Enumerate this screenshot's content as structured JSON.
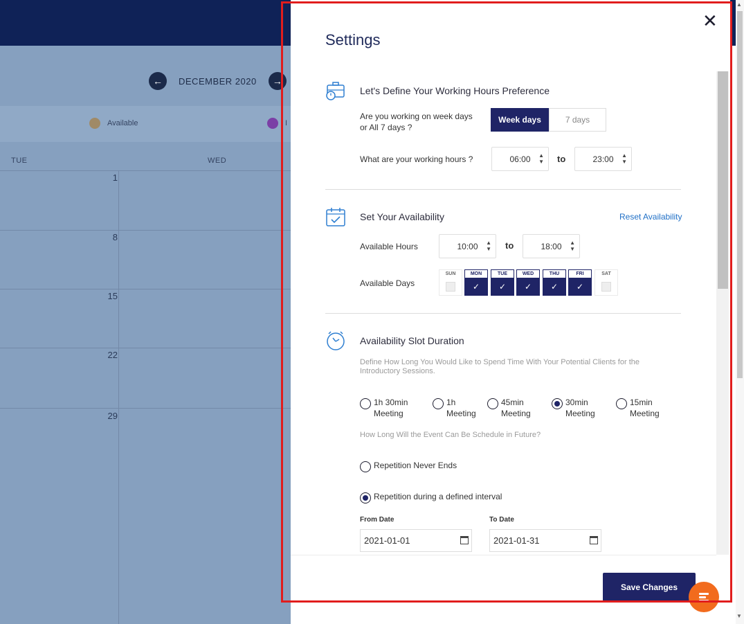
{
  "calendar": {
    "month": "DECEMBER 2020",
    "legend": [
      {
        "label": "Available",
        "color": "#a08a67"
      },
      {
        "label": "I",
        "color": "#7b3fa6"
      }
    ],
    "day_headers": [
      "TUE",
      "WED"
    ],
    "dates": [
      "1",
      "8",
      "15",
      "22",
      "29"
    ]
  },
  "settings": {
    "title": "Settings",
    "working_hours": {
      "title": "Let's Define Your Working Hours Preference",
      "week_question": "Are you working on week days or All 7 days ?",
      "options": [
        "Week days",
        "7 days"
      ],
      "selected": "Week days",
      "hours_question": "What are your working hours ?",
      "from": "06:00",
      "to_label": "to",
      "to": "23:00"
    },
    "availability": {
      "title": "Set Your Availability",
      "reset_link": "Reset Availability",
      "hours_label": "Available Hours",
      "from": "10:00",
      "to_label": "to",
      "to": "18:00",
      "days_label": "Available Days",
      "days": [
        {
          "label": "SUN",
          "checked": false
        },
        {
          "label": "MON",
          "checked": true
        },
        {
          "label": "TUE",
          "checked": true
        },
        {
          "label": "WED",
          "checked": true
        },
        {
          "label": "THU",
          "checked": true
        },
        {
          "label": "FRI",
          "checked": true
        },
        {
          "label": "SAT",
          "checked": false
        }
      ]
    },
    "slot": {
      "title": "Availability Slot Duration",
      "description": "Define How Long You Would Like to Spend Time With Your Potential Clients for the Introductory Sessions.",
      "durations": [
        {
          "line1": "1h 30min",
          "line2": "Meeting",
          "selected": false
        },
        {
          "line1": "1h",
          "line2": "Meeting",
          "selected": false
        },
        {
          "line1": "45min",
          "line2": "Meeting",
          "selected": false
        },
        {
          "line1": "30min",
          "line2": "Meeting",
          "selected": true
        },
        {
          "line1": "15min",
          "line2": "Meeting",
          "selected": false
        }
      ],
      "future_question": "How Long Will the Event Can Be Schedule in Future?",
      "repetition_never": "Repetition Never Ends",
      "repetition_interval": "Repetition during a defined interval",
      "repetition_selected": "interval",
      "from_date_label": "From Date",
      "from_date": "2021-01-01",
      "to_date_label": "To Date",
      "to_date": "2021-01-31"
    },
    "save_label": "Save Changes",
    "close_icon": "close-icon",
    "highlight_color": "#e11d1d"
  }
}
